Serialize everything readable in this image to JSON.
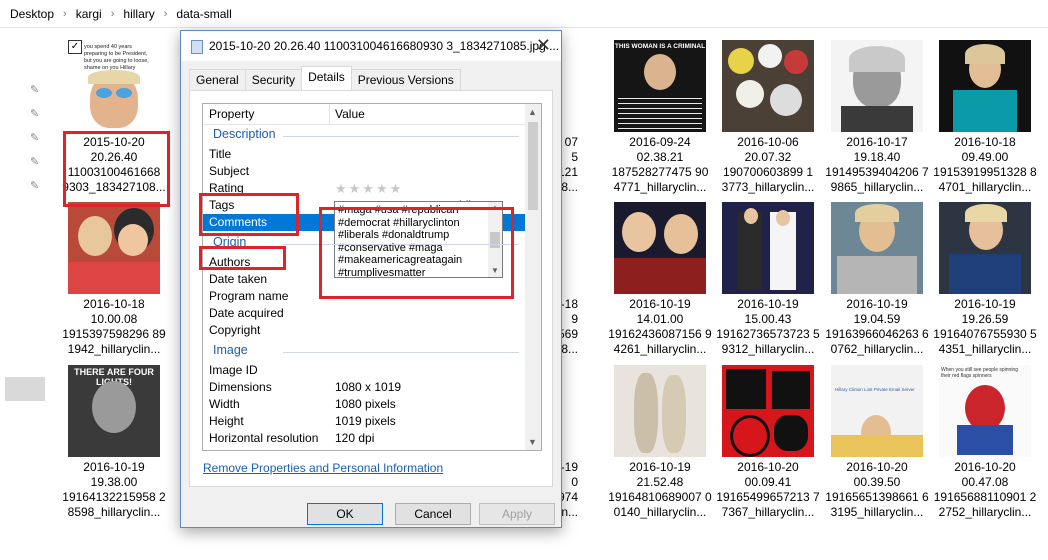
{
  "breadcrumb": [
    "Desktop",
    "kargi",
    "hillary",
    "data-small"
  ],
  "dialog": {
    "title": "2015-10-20 20.26.40 110031004616680930 3_1834271085.jpg ...",
    "tabs": [
      "General",
      "Security",
      "Details",
      "Previous Versions"
    ],
    "active_tab": "Details",
    "columns": {
      "property": "Property",
      "value": "Value"
    },
    "sections": {
      "description": "Description",
      "origin": "Origin",
      "image": "Image"
    },
    "description_rows": [
      {
        "k": "Title",
        "v": ""
      },
      {
        "k": "Subject",
        "v": ""
      },
      {
        "k": "Rating",
        "v": ""
      },
      {
        "k": "Tags",
        "v": "trump; maga; usa; republican; de..."
      },
      {
        "k": "Comments",
        "v": ""
      }
    ],
    "comments_lines": [
      "#maga #usa #republican",
      "#democrat #hillaryclinton",
      "#liberals #donaldtrump",
      "#conservative #maga",
      "#makeamericagreatagain",
      "#trumplivesmatter"
    ],
    "origin_rows": [
      {
        "k": "Authors",
        "v": ""
      },
      {
        "k": "Date taken",
        "v": ""
      },
      {
        "k": "Program name",
        "v": ""
      },
      {
        "k": "Date acquired",
        "v": ""
      },
      {
        "k": "Copyright",
        "v": ""
      }
    ],
    "image_rows": [
      {
        "k": "Image ID",
        "v": ""
      },
      {
        "k": "Dimensions",
        "v": "1080 x 1019"
      },
      {
        "k": "Width",
        "v": "1080 pixels"
      },
      {
        "k": "Height",
        "v": "1019 pixels"
      },
      {
        "k": "Horizontal resolution",
        "v": "120 dpi"
      },
      {
        "k": "Vertical resolution",
        "v": "120 dpi"
      }
    ],
    "remove_link": "Remove Properties and Personal Information",
    "buttons": {
      "ok": "OK",
      "cancel": "Cancel",
      "apply": "Apply"
    }
  },
  "files": [
    {
      "l1": "2015-10-20",
      "l2": "20.26.40",
      "l3": "11003100461668",
      "l4": "9303_183427108...",
      "art": "hillary-meme",
      "selected": true
    },
    {
      "l1": "2016-10-18",
      "l2": "10.00.08",
      "l3": "1915397598296 89",
      "l4": "1942_hillaryclin...",
      "art": "photo-red"
    },
    {
      "l1": "2016-10-19",
      "l2": "19.38.00",
      "l3": "19164132215958 2",
      "l4": "8598_hillaryclin...",
      "art": "four-lights"
    },
    {
      "l1": "07",
      "l2": "5",
      "l3": "72121",
      "l4": "1708...",
      "art": "partial-dark"
    },
    {
      "l1": "-18",
      "l2": "9",
      "l3": "59569",
      "l4": "1708...",
      "art": "partial-blue"
    },
    {
      "l1": "-19",
      "l2": "0",
      "l3": "72974",
      "l4": "clin...",
      "art": "partial-red"
    },
    {
      "l1": "2016-09-24",
      "l2": "02.38.21",
      "l3": "187528277475 90",
      "l4": "4771_hillaryclin...",
      "art": "criminal"
    },
    {
      "l1": "2016-10-19",
      "l2": "14.01.00",
      "l3": "19162436087156 9",
      "l4": "4261_hillaryclin...",
      "art": "photo-dark"
    },
    {
      "l1": "2016-10-19",
      "l2": "21.52.48",
      "l3": "19164810689007 0",
      "l4": "0140_hillaryclin...",
      "art": "statue"
    },
    {
      "l1": "2016-10-06",
      "l2": "20.07.32",
      "l3": "190700603899 1",
      "l4": "3773_hillaryclin...",
      "art": "buttons"
    },
    {
      "l1": "2016-10-19",
      "l2": "15.00.43",
      "l3": "19162736573723 5",
      "l4": "9312_hillaryclin...",
      "art": "stage"
    },
    {
      "l1": "2016-10-20",
      "l2": "00.09.41",
      "l3": "19165499657213 7",
      "l4": "7367_hillaryclin...",
      "art": "cartoon"
    },
    {
      "l1": "2016-10-17",
      "l2": "19.18.40",
      "l3": "19149539404206 7",
      "l4": "9865_hillaryclin...",
      "art": "portrait-bw"
    },
    {
      "l1": "2016-10-19",
      "l2": "19.04.59",
      "l3": "19163966046263 6",
      "l4": "0762_hillaryclin...",
      "art": "crowd"
    },
    {
      "l1": "2016-10-20",
      "l2": "00.39.50",
      "l3": "19165651398661 6",
      "l4": "3195_hillaryclin...",
      "art": "news"
    },
    {
      "l1": "2016-10-18",
      "l2": "09.49.00",
      "l3": "19153919951328 8",
      "l4": "4701_hillaryclin...",
      "art": "portrait-teal"
    },
    {
      "l1": "2016-10-19",
      "l2": "19.26.59",
      "l3": "19164076755930 5",
      "l4": "4351_hillaryclin...",
      "art": "crowd2"
    },
    {
      "l1": "2016-10-20",
      "l2": "00.47.08",
      "l3": "19165688110901 2",
      "l4": "2752_hillaryclin...",
      "art": "spiderman"
    }
  ],
  "meme_text": "you spend 40 years preparing to be President, but you are going to loose, shame on you Hillary",
  "criminal_text": "THIS WOMAN IS A CRIMINAL",
  "four_lights_text": "THERE ARE FOUR LIGHTS!",
  "spiderman_text": "When you still see people spinning their red flags spinners"
}
